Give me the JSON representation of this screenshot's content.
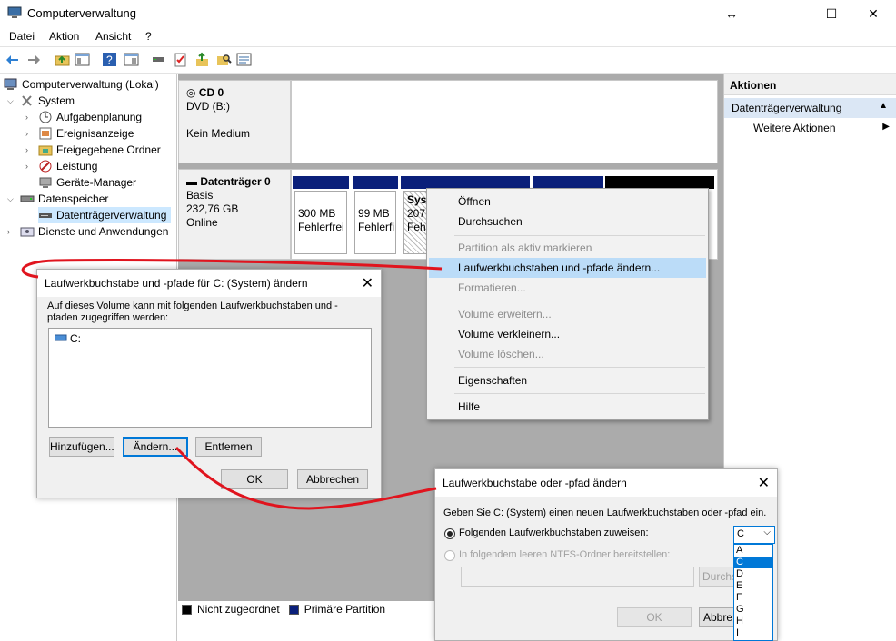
{
  "window": {
    "title": "Computerverwaltung",
    "controls": [
      "↔",
      "—",
      "☐",
      "✕"
    ]
  },
  "menu": [
    "Datei",
    "Aktion",
    "Ansicht",
    "?"
  ],
  "tree": {
    "items": [
      {
        "label": "Computerverwaltung (Lokal)",
        "icon": "computer-management-icon"
      },
      {
        "label": "System",
        "icon": "tools-icon"
      },
      {
        "label": "Aufgabenplanung",
        "icon": "clock-icon"
      },
      {
        "label": "Ereignisanzeige",
        "icon": "event-viewer-icon"
      },
      {
        "label": "Freigegebene Ordner",
        "icon": "shared-folder-icon"
      },
      {
        "label": "Leistung",
        "icon": "performance-icon"
      },
      {
        "label": "Geräte-Manager",
        "icon": "device-manager-icon"
      },
      {
        "label": "Datenspeicher",
        "icon": "storage-icon"
      },
      {
        "label": "Datenträgerverwaltung",
        "icon": "disk-management-icon"
      },
      {
        "label": "Dienste und Anwendungen",
        "icon": "services-icon"
      }
    ]
  },
  "disks": {
    "cd": {
      "name": "CD 0",
      "type": "DVD (B:)",
      "status": "Kein Medium"
    },
    "disk0": {
      "name": "Datenträger 0",
      "type": "Basis",
      "size": "232,76 GB",
      "status": "Online"
    },
    "partitions": [
      {
        "size": "300 MB",
        "status": "Fehlerfrei"
      },
      {
        "size": "99 MB",
        "status": "Fehlerfi"
      },
      {
        "name": "Sys",
        "size": "207,",
        "status": "Feh"
      }
    ]
  },
  "legend": {
    "unallocated": "Nicht zugeordnet",
    "primary": "Primäre Partition"
  },
  "actions": {
    "header": "Aktionen",
    "section": "Datenträgerverwaltung",
    "more": "Weitere Aktionen"
  },
  "context_menu": [
    {
      "label": "Öffnen",
      "enabled": true
    },
    {
      "label": "Durchsuchen",
      "enabled": true
    },
    {
      "label": "Partition als aktiv markieren",
      "enabled": false
    },
    {
      "label": "Laufwerkbuchstaben und -pfade ändern...",
      "enabled": true,
      "highlighted": true
    },
    {
      "label": "Formatieren...",
      "enabled": false
    },
    {
      "label": "Volume erweitern...",
      "enabled": false
    },
    {
      "label": "Volume verkleinern...",
      "enabled": true
    },
    {
      "label": "Volume löschen...",
      "enabled": false
    },
    {
      "label": "Eigenschaften",
      "enabled": true
    },
    {
      "label": "Hilfe",
      "enabled": true
    }
  ],
  "dialog1": {
    "title": "Laufwerkbuchstabe und -pfade für C: (System) ändern",
    "description": "Auf dieses Volume kann mit folgenden Laufwerkbuchstaben und -pfaden zugegriffen werden:",
    "list_item": "C:",
    "add": "Hinzufügen...",
    "change": "Ändern...",
    "remove": "Entfernen",
    "ok": "OK",
    "cancel": "Abbrechen"
  },
  "dialog2": {
    "title": "Laufwerkbuchstabe oder -pfad ändern",
    "prompt": "Geben Sie C: (System) einen neuen Laufwerkbuchstaben oder -pfad ein.",
    "option_letter": "Folgenden Laufwerkbuchstaben zuweisen:",
    "option_folder": "In folgendem leeren NTFS-Ordner bereitstellen:",
    "browse": "Durchs",
    "ok": "OK",
    "cancel": "Abbre",
    "selected_letter": "C"
  },
  "letter_options": [
    "A",
    "C",
    "D",
    "E",
    "F",
    "G",
    "H",
    "I"
  ],
  "colors": {
    "primary_partition": "#0a1f7a",
    "unallocated": "#000000",
    "highlight": "#bbdcf8",
    "accent": "#0078d7",
    "annotation": "#e0141e"
  }
}
